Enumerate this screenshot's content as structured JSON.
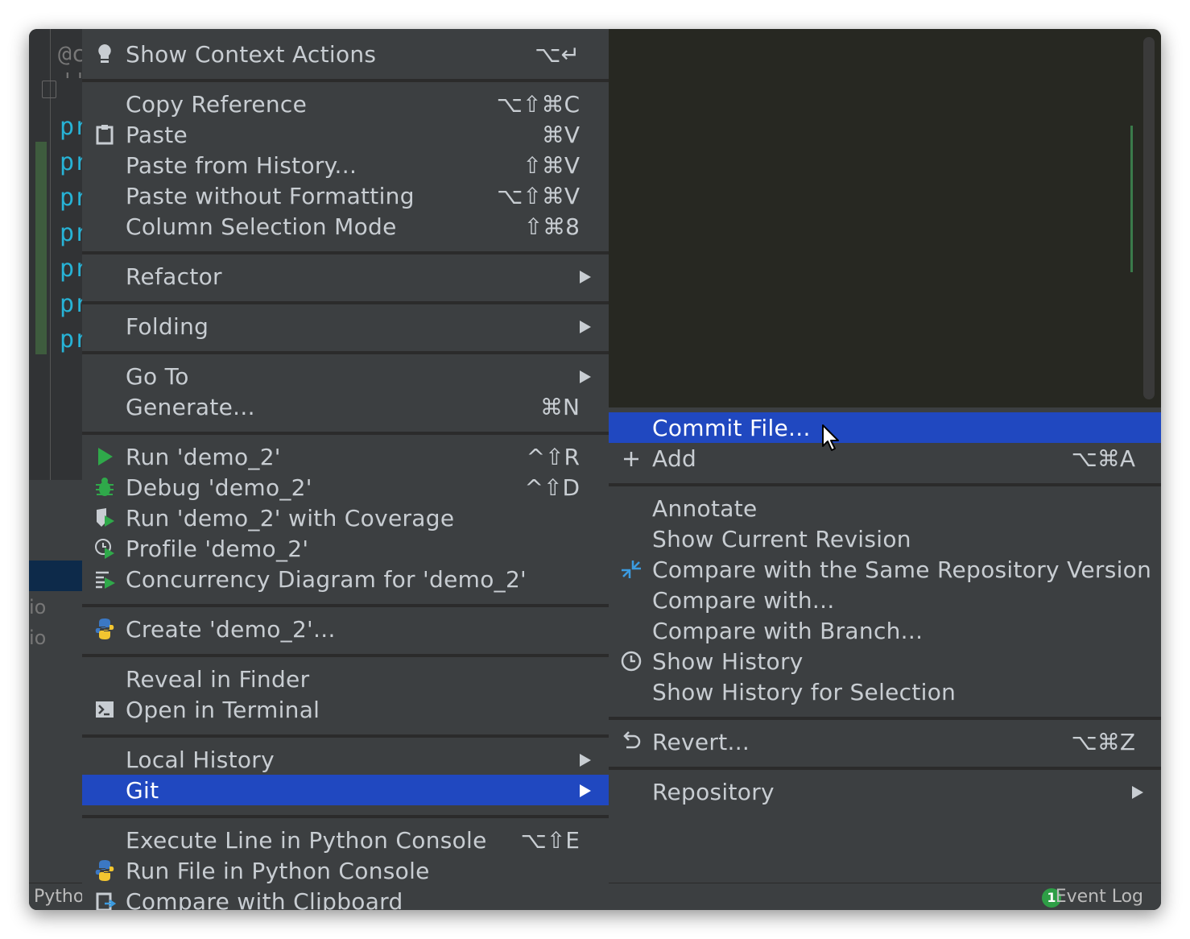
{
  "editor": {
    "annotation": "@c",
    "quote_text": "'''",
    "code_prefix": "pr",
    "code_prefix_lines": [
      "pr",
      "pr",
      "pr",
      "pr",
      "pr",
      "pr",
      "pr"
    ],
    "lower_texts": [
      "io",
      "io"
    ]
  },
  "status_bar": {
    "left_text": "Pytho",
    "event_badge_count": "1",
    "event_log_label": "Event Log"
  },
  "context_menu": {
    "show_context_actions": {
      "label": "Show Context Actions",
      "shortcut": "⌥↵"
    },
    "copy_reference": {
      "label": "Copy Reference",
      "shortcut": "⌥⇧⌘C"
    },
    "paste": {
      "label": "Paste",
      "shortcut": "⌘V"
    },
    "paste_from_history": {
      "label": "Paste from History...",
      "shortcut": "⇧⌘V"
    },
    "paste_without_formatting": {
      "label": "Paste without Formatting",
      "shortcut": "⌥⇧⌘V"
    },
    "column_selection_mode": {
      "label": "Column Selection Mode",
      "shortcut": "⇧⌘8"
    },
    "refactor": {
      "label": "Refactor"
    },
    "folding": {
      "label": "Folding"
    },
    "go_to": {
      "label": "Go To"
    },
    "generate": {
      "label": "Generate...",
      "shortcut": "⌘N"
    },
    "run": {
      "label": "Run 'demo_2'",
      "shortcut": "^⇧R"
    },
    "debug": {
      "label": "Debug 'demo_2'",
      "shortcut": "^⇧D"
    },
    "run_coverage": {
      "label": "Run 'demo_2' with Coverage"
    },
    "profile": {
      "label": "Profile 'demo_2'"
    },
    "concurrency": {
      "label": "Concurrency Diagram for 'demo_2'"
    },
    "create": {
      "label": "Create 'demo_2'..."
    },
    "reveal_finder": {
      "label": "Reveal in Finder"
    },
    "open_terminal": {
      "label": "Open in Terminal"
    },
    "local_history": {
      "label": "Local History"
    },
    "git": {
      "label": "Git"
    },
    "execute_line": {
      "label": "Execute Line in Python Console",
      "shortcut": "⌥⇧E"
    },
    "run_file_console": {
      "label": "Run File in Python Console"
    },
    "compare_clipboard": {
      "label": "Compare with Clipboard"
    }
  },
  "git_submenu": {
    "commit_file": {
      "label": "Commit File..."
    },
    "add": {
      "label": "Add",
      "shortcut": "⌥⌘A"
    },
    "annotate": {
      "label": "Annotate"
    },
    "show_current_revision": {
      "label": "Show Current Revision"
    },
    "compare_same_repo": {
      "label": "Compare with the Same Repository Version"
    },
    "compare_with": {
      "label": "Compare with..."
    },
    "compare_branch": {
      "label": "Compare with Branch..."
    },
    "show_history": {
      "label": "Show History"
    },
    "show_history_selection": {
      "label": "Show History for Selection"
    },
    "revert": {
      "label": "Revert...",
      "shortcut": "⌥⌘Z"
    },
    "repository": {
      "label": "Repository"
    }
  },
  "colors": {
    "selection": "#2048c0",
    "menu_bg": "#3c3f41",
    "run_green": "#2fa94a"
  }
}
